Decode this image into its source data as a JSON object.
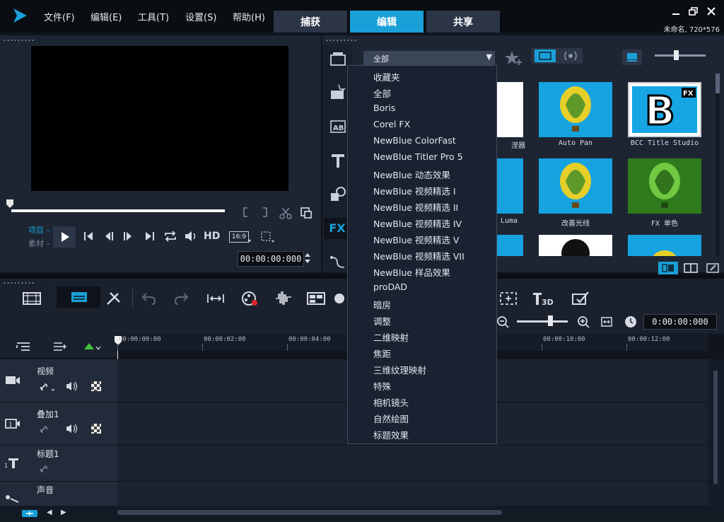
{
  "app": {
    "window_title": "未命名, 720*576"
  },
  "menu": [
    "文件(F)",
    "编辑(E)",
    "工具(T)",
    "设置(S)",
    "帮助(H)"
  ],
  "tabs": [
    {
      "label": "捕获",
      "active": false
    },
    {
      "label": "编辑",
      "active": true
    },
    {
      "label": "共享",
      "active": false
    }
  ],
  "player": {
    "mode_project": "项目",
    "mode_clip": "素材",
    "hd_label": "HD",
    "aspect": "16:9",
    "timecode": "00:00:00:000"
  },
  "library": {
    "category_selected": "全部",
    "sidebar_fx_label": "FX",
    "thumbnails": [
      {
        "label": "混合器",
        "visible_label": "涅器"
      },
      {
        "label": "Auto Pan"
      },
      {
        "label": "BCC Title Studio"
      },
      {
        "label": "Luma"
      },
      {
        "label": "改善光线"
      },
      {
        "label": "FX 单色"
      }
    ]
  },
  "dropdown": {
    "items": [
      "收藏夹",
      "全部",
      "Boris",
      "Corel FX",
      "NewBlue ColorFast",
      "NewBlue Titler Pro 5",
      "NewBlue 动态效果",
      "NewBlue 视频精选 I",
      "NewBlue 视频精选 II",
      "NewBlue 视频精选 IV",
      "NewBlue 视频精选 V",
      "NewBlue 视频精选 VII",
      "NewBlue 样品效果",
      "proDAD",
      "暗房",
      "调整",
      "二维映射",
      "焦距",
      "三维纹理映射",
      "特殊",
      "相机镜头",
      "自然绘图",
      "标题效果"
    ]
  },
  "timeline": {
    "timecode": "0:00:00:000",
    "ruler": [
      "00:00:00:00",
      "00:00:02:00",
      "00:00:04:00",
      "00:00:10:00",
      "00:00:12:00"
    ],
    "tracks": [
      "视频",
      "叠加1",
      "标题1",
      "声音"
    ]
  },
  "colors": {
    "accent": "#1aa0d8",
    "brand": "#1aa0d8"
  }
}
